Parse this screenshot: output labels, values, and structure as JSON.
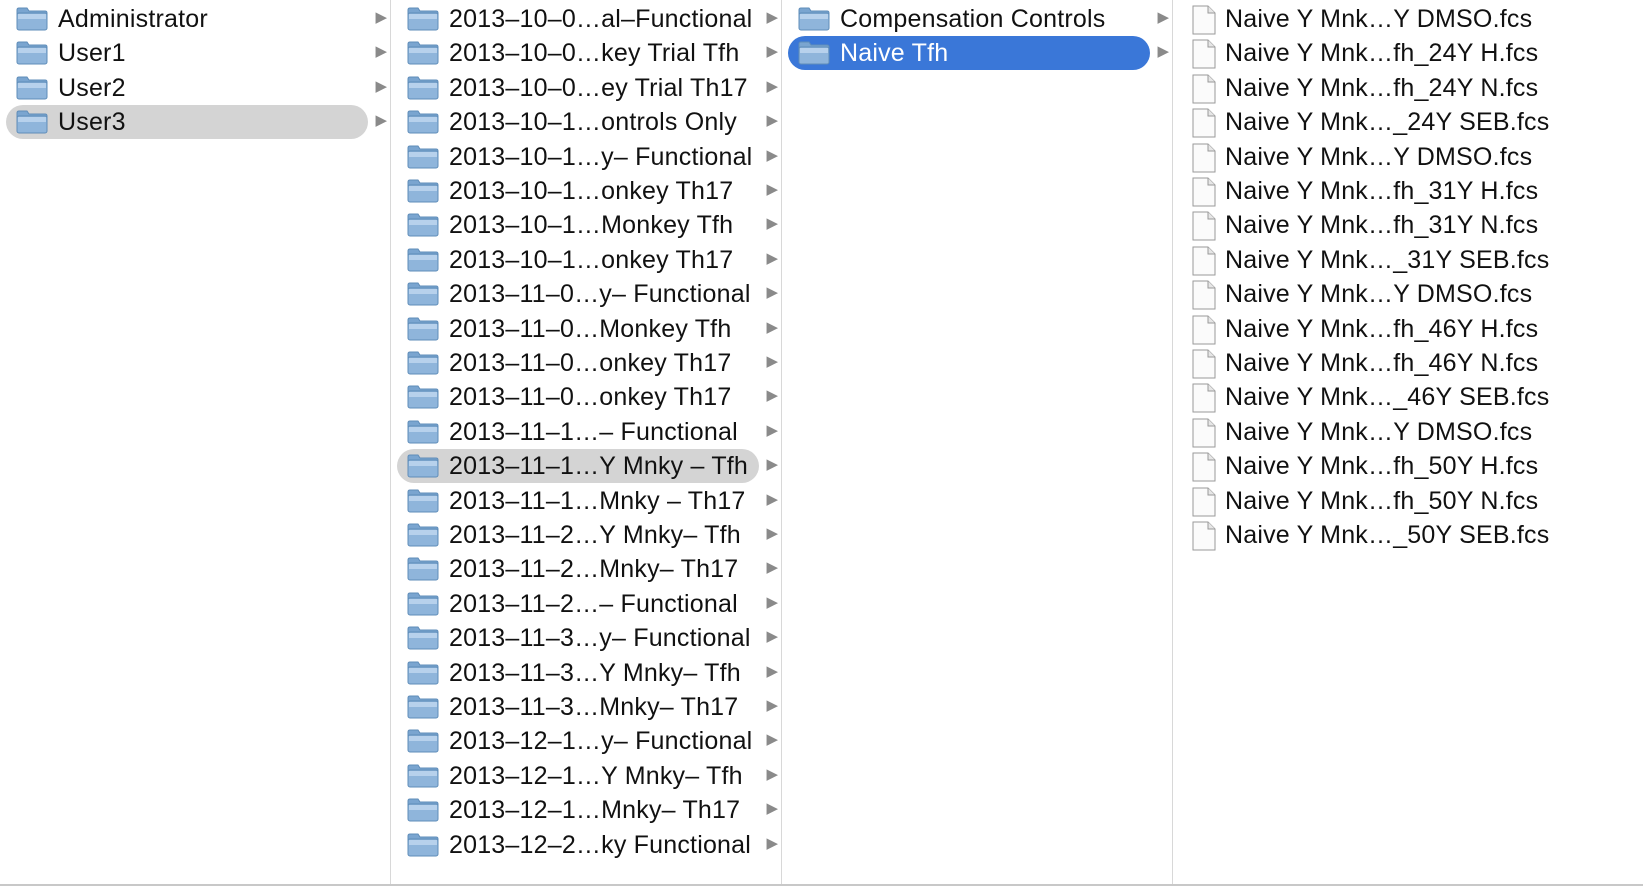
{
  "columns": [
    {
      "id": "users",
      "items": [
        {
          "label": "Administrator",
          "kind": "folder",
          "selected": "none"
        },
        {
          "label": "User1",
          "kind": "folder",
          "selected": "none"
        },
        {
          "label": "User2",
          "kind": "folder",
          "selected": "none"
        },
        {
          "label": "User3",
          "kind": "folder",
          "selected": "inactive"
        }
      ]
    },
    {
      "id": "experiments",
      "items": [
        {
          "label": "2013–10–0…al–Functional",
          "kind": "folder",
          "selected": "none"
        },
        {
          "label": "2013–10–0…key Trial Tfh",
          "kind": "folder",
          "selected": "none"
        },
        {
          "label": "2013–10–0…ey Trial Th17",
          "kind": "folder",
          "selected": "none"
        },
        {
          "label": "2013–10–1…ontrols Only",
          "kind": "folder",
          "selected": "none"
        },
        {
          "label": "2013–10–1…y– Functional",
          "kind": "folder",
          "selected": "none"
        },
        {
          "label": "2013–10–1…onkey Th17",
          "kind": "folder",
          "selected": "none"
        },
        {
          "label": "2013–10–1…Monkey Tfh",
          "kind": "folder",
          "selected": "none"
        },
        {
          "label": "2013–10–1…onkey Th17",
          "kind": "folder",
          "selected": "none"
        },
        {
          "label": "2013–11–0…y– Functional",
          "kind": "folder",
          "selected": "none"
        },
        {
          "label": "2013–11–0…Monkey Tfh",
          "kind": "folder",
          "selected": "none"
        },
        {
          "label": "2013–11–0…onkey Th17",
          "kind": "folder",
          "selected": "none"
        },
        {
          "label": "2013–11–0…onkey Th17",
          "kind": "folder",
          "selected": "none"
        },
        {
          "label": "2013–11–1…– Functional",
          "kind": "folder",
          "selected": "none"
        },
        {
          "label": "2013–11–1…Y Mnky – Tfh",
          "kind": "folder",
          "selected": "inactive"
        },
        {
          "label": "2013–11–1…Mnky – Th17",
          "kind": "folder",
          "selected": "none"
        },
        {
          "label": "2013–11–2…Y Mnky– Tfh",
          "kind": "folder",
          "selected": "none"
        },
        {
          "label": "2013–11–2…Mnky– Th17",
          "kind": "folder",
          "selected": "none"
        },
        {
          "label": "2013–11–2…– Functional",
          "kind": "folder",
          "selected": "none"
        },
        {
          "label": "2013–11–3…y– Functional",
          "kind": "folder",
          "selected": "none"
        },
        {
          "label": "2013–11–3…Y Mnky– Tfh",
          "kind": "folder",
          "selected": "none"
        },
        {
          "label": "2013–11–3…Mnky– Th17",
          "kind": "folder",
          "selected": "none"
        },
        {
          "label": "2013–12–1…y– Functional",
          "kind": "folder",
          "selected": "none"
        },
        {
          "label": "2013–12–1…Y Mnky– Tfh",
          "kind": "folder",
          "selected": "none"
        },
        {
          "label": "2013–12–1…Mnky– Th17",
          "kind": "folder",
          "selected": "none"
        },
        {
          "label": "2013–12–2…ky Functional",
          "kind": "folder",
          "selected": "none"
        }
      ]
    },
    {
      "id": "groups",
      "items": [
        {
          "label": "Compensation Controls",
          "kind": "folder",
          "selected": "none"
        },
        {
          "label": "Naive Tfh",
          "kind": "folder",
          "selected": "active"
        }
      ]
    },
    {
      "id": "files",
      "items": [
        {
          "label": "Naive Y Mnk…Y DMSO.fcs",
          "kind": "file"
        },
        {
          "label": "Naive Y Mnk…fh_24Y H.fcs",
          "kind": "file"
        },
        {
          "label": "Naive Y Mnk…fh_24Y N.fcs",
          "kind": "file"
        },
        {
          "label": "Naive Y Mnk…_24Y SEB.fcs",
          "kind": "file"
        },
        {
          "label": "Naive Y Mnk…Y DMSO.fcs",
          "kind": "file"
        },
        {
          "label": "Naive Y Mnk…fh_31Y H.fcs",
          "kind": "file"
        },
        {
          "label": "Naive Y Mnk…fh_31Y N.fcs",
          "kind": "file"
        },
        {
          "label": "Naive Y Mnk…_31Y SEB.fcs",
          "kind": "file"
        },
        {
          "label": "Naive Y Mnk…Y DMSO.fcs",
          "kind": "file"
        },
        {
          "label": "Naive Y Mnk…fh_46Y H.fcs",
          "kind": "file"
        },
        {
          "label": "Naive Y Mnk…fh_46Y N.fcs",
          "kind": "file"
        },
        {
          "label": "Naive Y Mnk…_46Y SEB.fcs",
          "kind": "file"
        },
        {
          "label": "Naive Y Mnk…Y DMSO.fcs",
          "kind": "file"
        },
        {
          "label": "Naive Y Mnk…fh_50Y H.fcs",
          "kind": "file"
        },
        {
          "label": "Naive Y Mnk…fh_50Y N.fcs",
          "kind": "file"
        },
        {
          "label": "Naive Y Mnk…_50Y SEB.fcs",
          "kind": "file"
        }
      ]
    }
  ],
  "colors": {
    "selection_active": "#3a77d8",
    "selection_inactive": "#d4d4d4",
    "folder_fill": "#8fb5db",
    "folder_tab": "#7aa5d0",
    "disclosure_arrow": "#8a8a8a"
  }
}
